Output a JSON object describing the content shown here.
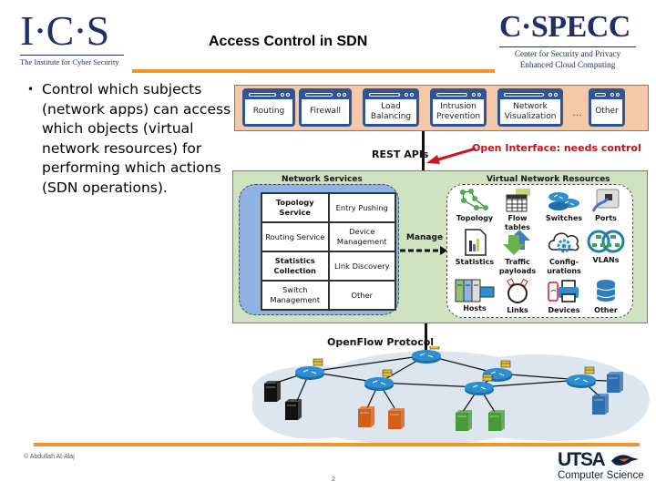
{
  "header": {
    "ics_logo": {
      "mark": "I·C·S",
      "subtitle": "The Institute for Cyber Security"
    },
    "title": "Access Control in SDN",
    "cspecc_logo": {
      "mark": "C·SPECC",
      "subtitle_line1": "Center for Security and Privacy",
      "subtitle_line2": "Enhanced Cloud Computing"
    },
    "accent_color": "#f0962a",
    "brand_color": "#1f2f6b"
  },
  "bullet": {
    "text": "Control which subjects (network apps) can access which objects (virtual network resources) for performing which actions (SDN operations)."
  },
  "diagram": {
    "apps": [
      {
        "label": "Routing"
      },
      {
        "label": "Firewall"
      },
      {
        "label": "Load Balancing"
      },
      {
        "label": "Intrusion Prevention"
      },
      {
        "label": "Network Visualization"
      },
      {
        "label": "Other"
      }
    ],
    "apps_ellipsis": "…",
    "rest_apis_label": "REST APIs",
    "open_interface_note": "Open Interface: needs control",
    "network_services": {
      "title": "Network Services",
      "cells": [
        {
          "label": "Topology Service",
          "bold": true
        },
        {
          "label": "Entry Pushing",
          "bold": false
        },
        {
          "label": "Routing Service",
          "bold": false
        },
        {
          "label": "Device Management",
          "bold": false
        },
        {
          "label": "Statistics Collection",
          "bold": true
        },
        {
          "label": "Link Discovery",
          "bold": false
        },
        {
          "label": "Switch Management",
          "bold": false
        },
        {
          "label": "Other",
          "bold": false
        }
      ]
    },
    "manage_label": "Manage",
    "virtual_network_resources": {
      "title": "Virtual Network Resources",
      "items": [
        {
          "label": "Topology",
          "icon": "topology-icon"
        },
        {
          "label": "Flow tables",
          "icon": "flow-table-icon"
        },
        {
          "label": "Switches",
          "icon": "switch-icon"
        },
        {
          "label": "Ports",
          "icon": "port-icon"
        },
        {
          "label": "Statistics",
          "icon": "statistics-icon"
        },
        {
          "label": "Traffic payloads",
          "icon": "traffic-icon"
        },
        {
          "label": "Config-urations",
          "icon": "configuration-icon"
        },
        {
          "label": "VLANs",
          "icon": "vlan-icon"
        },
        {
          "label": "Hosts",
          "icon": "host-icon"
        },
        {
          "label": "Links",
          "icon": "link-icon"
        },
        {
          "label": "Devices",
          "icon": "device-icon"
        },
        {
          "label": "Other",
          "icon": "database-icon"
        }
      ]
    },
    "openflow_label": "OpenFlow Protocol"
  },
  "footer": {
    "copyright": "© Abdullah Al-Alaj",
    "page_number": "2",
    "utsa_logo": {
      "mark": "UTSA",
      "subtitle": "Computer Science"
    }
  }
}
